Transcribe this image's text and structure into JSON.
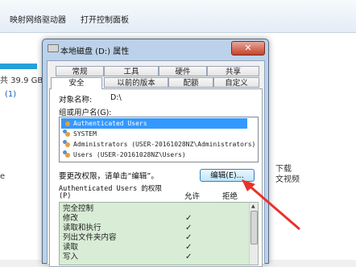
{
  "toolbar": {
    "map_drive": "映射网络驱动器",
    "control_panel": "打开控制面板"
  },
  "background": {
    "free_space": "共 39.9 GB",
    "count": "(1)",
    "left_small": "e",
    "download": "下载",
    "videos": "文视频"
  },
  "dialog": {
    "title": "本地磁盘 (D:) 属性",
    "close": "✕",
    "tabs_row1": [
      "常规",
      "工具",
      "硬件",
      "共享"
    ],
    "tabs_row2": [
      "安全",
      "以前的版本",
      "配额",
      "自定义"
    ],
    "object_label": "对象名称:",
    "object_value": "D:\\",
    "group_label": "组或用户名(G):",
    "users": [
      "Authenticated Users",
      "SYSTEM",
      "Administrators (USER-20161028NZ\\Administrators)",
      "Users (USER-20161028NZ\\Users)"
    ],
    "change_hint": "要更改权限，请单击“编辑”。",
    "edit_button": "编辑(E)...",
    "perm_for_line1": "Authenticated Users 的权限",
    "perm_for_line2": "(P)",
    "allow_header": "允许",
    "deny_header": "拒绝",
    "permissions": [
      {
        "name": "完全控制",
        "allow": false
      },
      {
        "name": "修改",
        "allow": true
      },
      {
        "name": "读取和执行",
        "allow": true
      },
      {
        "name": "列出文件夹内容",
        "allow": true
      },
      {
        "name": "读取",
        "allow": true
      },
      {
        "name": "写入",
        "allow": true
      }
    ],
    "check_mark": "✓"
  },
  "colors": {
    "accent": "#3399ff",
    "arrow": "#e8322b",
    "list_highlight": "#d8ecd6"
  }
}
